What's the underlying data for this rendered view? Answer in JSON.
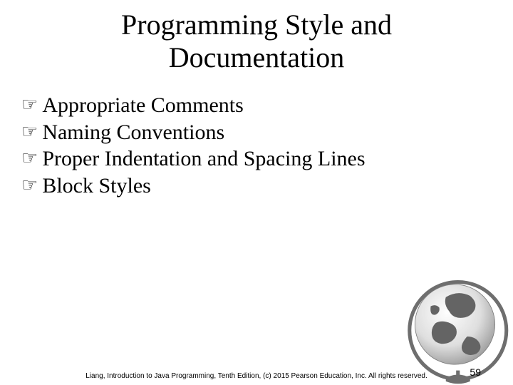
{
  "title_line1": "Programming Style and",
  "title_line2": "Documentation",
  "bullets": {
    "b0": "Appropriate Comments",
    "b1": "Naming Conventions",
    "b2": "Proper Indentation and Spacing Lines",
    "b3": "Block Styles"
  },
  "footer": "Liang, Introduction to Java Programming, Tenth Edition, (c) 2015 Pearson Education, Inc. All rights reserved.",
  "page_number": "59",
  "bullet_glyph": "☞"
}
